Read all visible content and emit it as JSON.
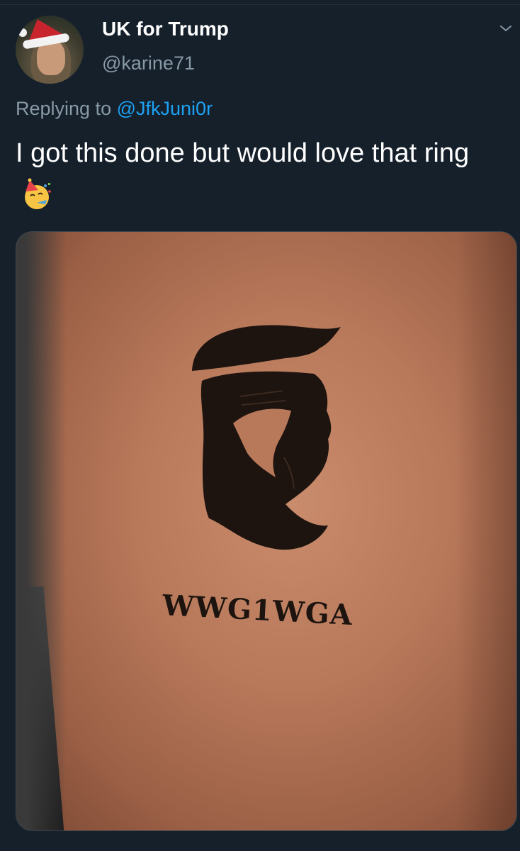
{
  "tweet": {
    "display_name": "UK for Trump",
    "handle": "@karine71",
    "replying_prefix": "Replying to",
    "replying_to": "@JfkJuni0r",
    "text": "I got this done but would love that ring",
    "emoji": "partying-face-emoji"
  },
  "media": {
    "tattoo_text": "WWG1WGA"
  },
  "icons": {
    "caret": "chevron-down-icon"
  },
  "colors": {
    "background": "#15202b",
    "text_primary": "#ffffff",
    "text_secondary": "#8899a6",
    "link": "#1da1f2"
  }
}
